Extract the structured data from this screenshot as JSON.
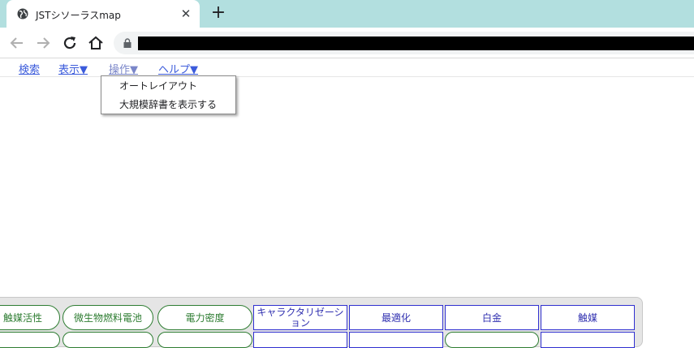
{
  "browser": {
    "tab_title": "JSTシソーラスmap",
    "tab_close": "✕",
    "new_tab": "+",
    "icons": {
      "favicon": "globe-icon",
      "back": "back-arrow-icon",
      "forward": "forward-arrow-icon",
      "reload": "reload-icon",
      "home": "home-icon",
      "lock": "lock-icon"
    },
    "colors": {
      "tabstrip": "#b2dfdf"
    }
  },
  "menu": {
    "items": [
      {
        "label": "検索"
      },
      {
        "label": "表示▼"
      },
      {
        "label": "操作▼"
      },
      {
        "label": "ヘルプ▼"
      }
    ]
  },
  "dropdown": {
    "items": [
      {
        "label": "オートレイアウト"
      },
      {
        "label": "大規模辞書を表示する"
      }
    ]
  },
  "terms": {
    "row1": [
      {
        "label": "触媒活性",
        "style": "green"
      },
      {
        "label": "微生物燃料電池",
        "style": "green"
      },
      {
        "label": "電力密度",
        "style": "green"
      },
      {
        "label": "キャラクタリゼーション",
        "style": "blue"
      },
      {
        "label": "最適化",
        "style": "blue"
      },
      {
        "label": "白金",
        "style": "blue"
      },
      {
        "label": "触媒",
        "style": "blue"
      }
    ],
    "colors": {
      "green": "#2e7d32",
      "blue": "#3030d0"
    }
  }
}
